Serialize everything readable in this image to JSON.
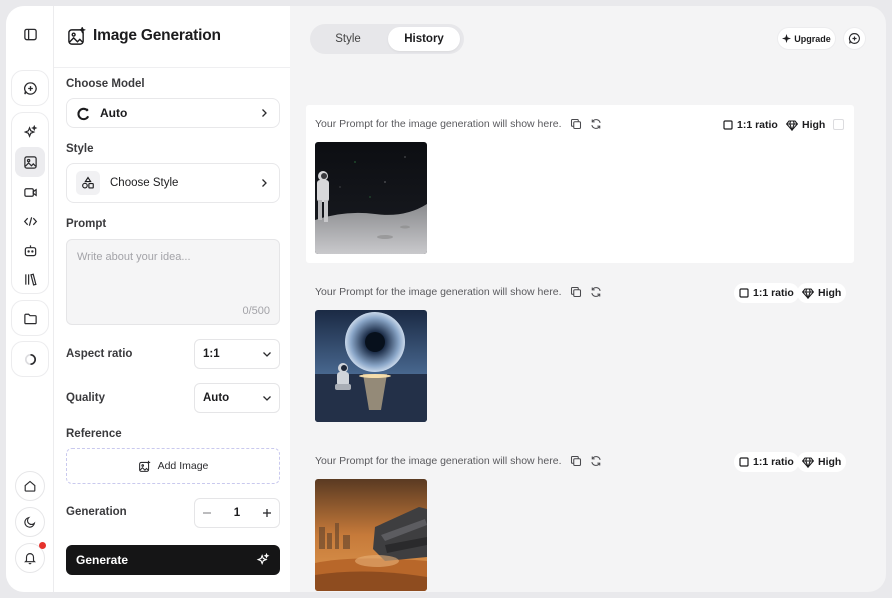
{
  "panel": {
    "title": "Image Generation",
    "choose_model_label": "Choose Model",
    "model_value": "Auto",
    "style_label": "Style",
    "style_value": "Choose Style",
    "prompt_label": "Prompt",
    "prompt_placeholder": "Write about your idea...",
    "prompt_counter": "0/500",
    "aspect_ratio_label": "Aspect ratio",
    "aspect_ratio_value": "1:1",
    "quality_label": "Quality",
    "quality_value": "Auto",
    "reference_label": "Reference",
    "add_image_label": "Add Image",
    "generation_label": "Generation",
    "generation_count": "1",
    "generate_label": "Generate"
  },
  "rail": {
    "icons": [
      "sidebar-toggle-icon",
      "new-chat-icon",
      "sparkles-icon",
      "image-icon",
      "video-icon",
      "code-icon",
      "bot-icon",
      "library-icon",
      "folder-icon",
      "loader-icon",
      "home-icon",
      "moon-icon",
      "bell-icon"
    ],
    "notification_color": "#e5322d"
  },
  "main": {
    "tabs": [
      {
        "label": "Style"
      },
      {
        "label": "History"
      }
    ],
    "active_tab": "History",
    "upgrade_label": "Upgrade",
    "history": [
      {
        "prompt": "Your Prompt for the image generation will show here.",
        "ratio": "1:1 ratio",
        "quality": "High",
        "image": "astronaut-on-moon"
      },
      {
        "prompt": "Your Prompt for the image generation will show here.",
        "ratio": "1:1 ratio",
        "quality": "High",
        "image": "astronaut-planet-ocean"
      },
      {
        "prompt": "Your Prompt for the image generation will show here.",
        "ratio": "1:1 ratio",
        "quality": "High",
        "image": "desert-spaceship"
      }
    ]
  },
  "colors": {
    "accent": "#151516",
    "panel_bg": "#ffffff",
    "main_bg": "#f4f4f5",
    "dashed_border": "#c9c9ee"
  }
}
